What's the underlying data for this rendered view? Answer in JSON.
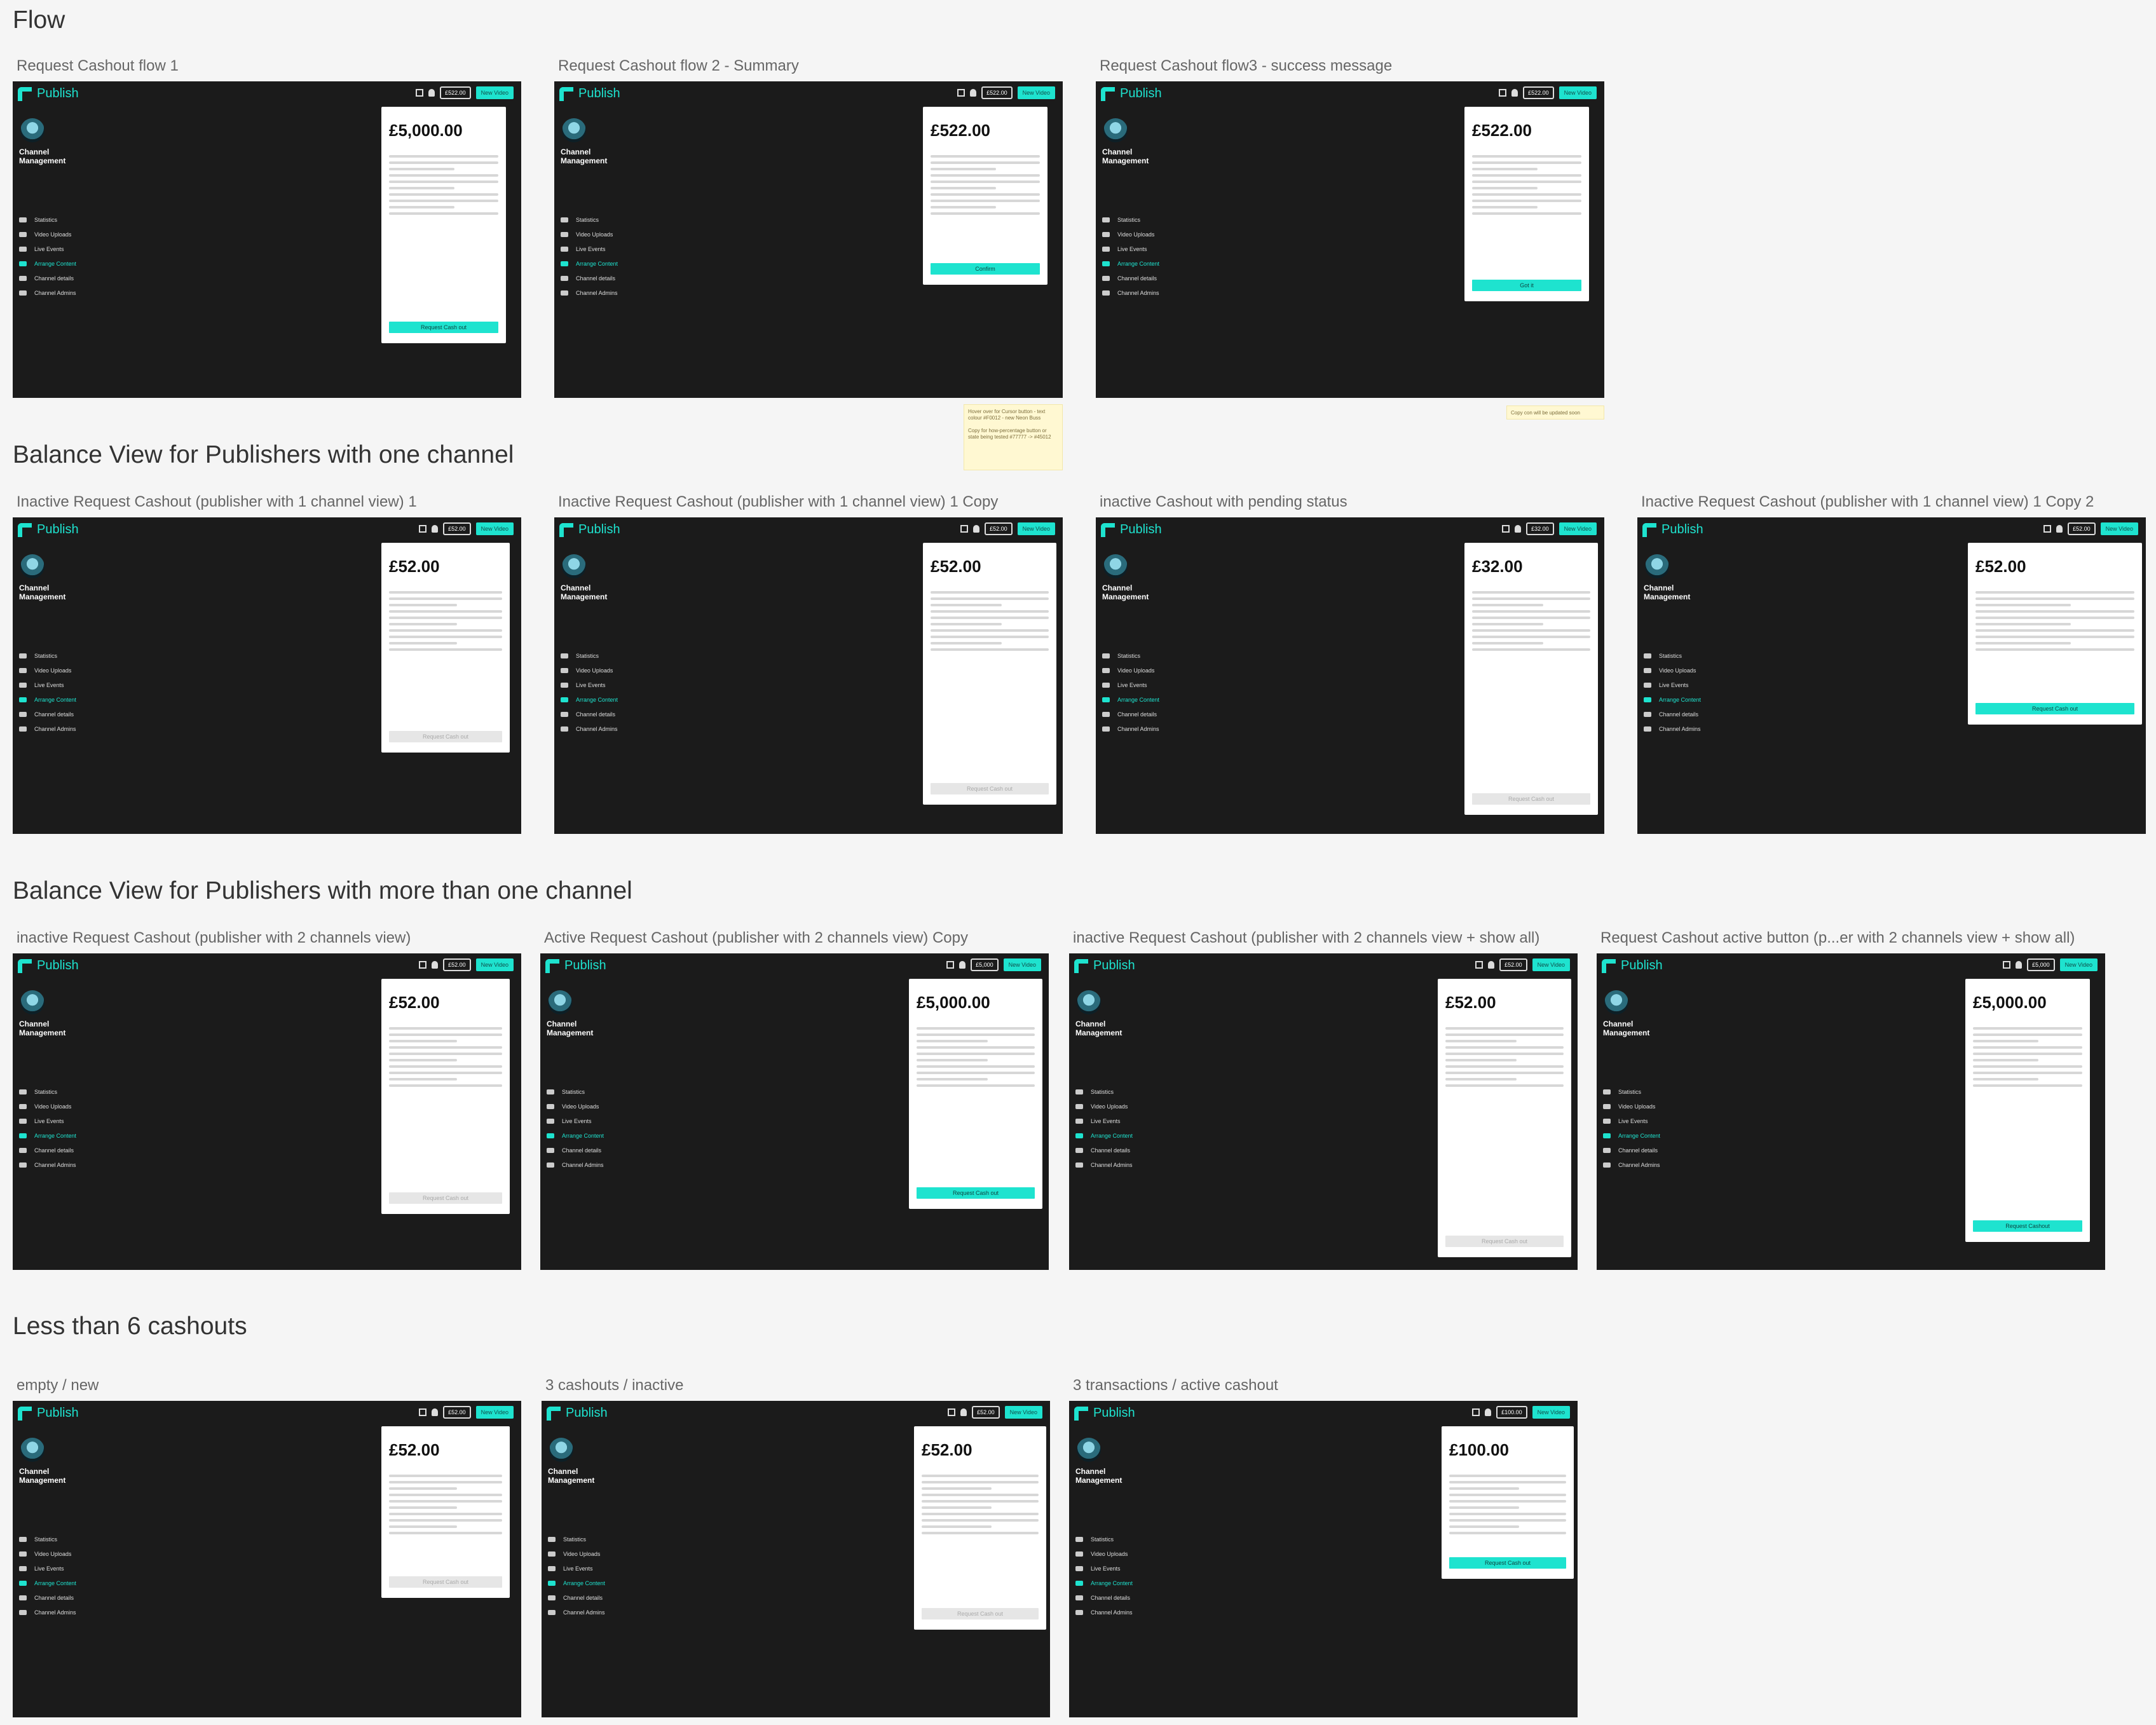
{
  "sections": [
    {
      "title": "Flow"
    },
    {
      "title": "Balance View for Publishers with one channel"
    },
    {
      "title": "Balance View for Publishers with more than one channel"
    },
    {
      "title": "Less than 6 cashouts"
    }
  ],
  "app": {
    "logo": "Publish",
    "new_video": "New Video",
    "channel_title": "Channel\nManagement",
    "nav": [
      "Statistics",
      "Video Uploads",
      "Live Events",
      "Arrange Content",
      "Channel details",
      "Channel Admins"
    ]
  },
  "frames": [
    {
      "label": "Request Cashout flow 1",
      "amount": "£5,000.00",
      "chip": "£522.00",
      "button": "Request Cash out",
      "button_state": "active"
    },
    {
      "label": "Request Cashout flow 2 - Summary",
      "amount": "£522.00",
      "chip": "£522.00",
      "button": "Confirm",
      "button_state": "active"
    },
    {
      "label": "Request Cashout flow3 - success message",
      "amount": "£522.00",
      "chip": "£522.00",
      "button": "Got it",
      "button_state": "active"
    },
    {
      "label": "Inactive Request Cashout (publisher with 1 channel view) 1",
      "amount": "£52.00",
      "chip": "£52.00",
      "button": "Request Cash out",
      "button_state": "disabled"
    },
    {
      "label": "Inactive Request Cashout (publisher with 1 channel view) 1 Copy",
      "amount": "£52.00",
      "chip": "£52.00",
      "button": "Request Cash out",
      "button_state": "disabled"
    },
    {
      "label": "inactive Cashout with pending status",
      "amount": "£32.00",
      "chip": "£32.00",
      "button": "Request Cash out",
      "button_state": "disabled"
    },
    {
      "label": "Inactive Request Cashout (publisher with 1 channel view) 1 Copy 2",
      "amount": "£52.00",
      "chip": "£52.00",
      "button": "Request Cash out",
      "button_state": "active"
    },
    {
      "label": "inactive Request Cashout (publisher with 2 channels view)",
      "amount": "£52.00",
      "chip": "£52.00",
      "button": "Request Cash out",
      "button_state": "disabled"
    },
    {
      "label": "Active Request Cashout (publisher with 2 channels view) Copy",
      "amount": "£5,000.00",
      "chip": "£5,000",
      "button": "Request Cash out",
      "button_state": "active"
    },
    {
      "label": "inactive Request Cashout (publisher with 2 channels view + show all)",
      "amount": "£52.00",
      "chip": "£52.00",
      "button": "Request Cash out",
      "button_state": "disabled"
    },
    {
      "label": "Request Cashout active button (p...er with 2 channels view + show all)",
      "amount": "£5,000.00",
      "chip": "£5,000",
      "button": "Request Cashout",
      "button_state": "active"
    },
    {
      "label": "empty / new",
      "amount": "£52.00",
      "chip": "£52.00",
      "button": "Request Cash out",
      "button_state": "disabled"
    },
    {
      "label": "3 cashouts / inactive",
      "amount": "£52.00",
      "chip": "£52.00",
      "button": "Request Cash out",
      "button_state": "disabled"
    },
    {
      "label": "3 transactions / active cashout",
      "amount": "£100.00",
      "chip": "£100.00",
      "button": "Request Cash out",
      "button_state": "active"
    }
  ],
  "notes": [
    "Hover over for Cursor button - text colour #F0012 - new Neon Buss\n\nCopy for how-percentage button or state being tested #77777 -> #45012",
    "Copy con will be updated soon"
  ]
}
